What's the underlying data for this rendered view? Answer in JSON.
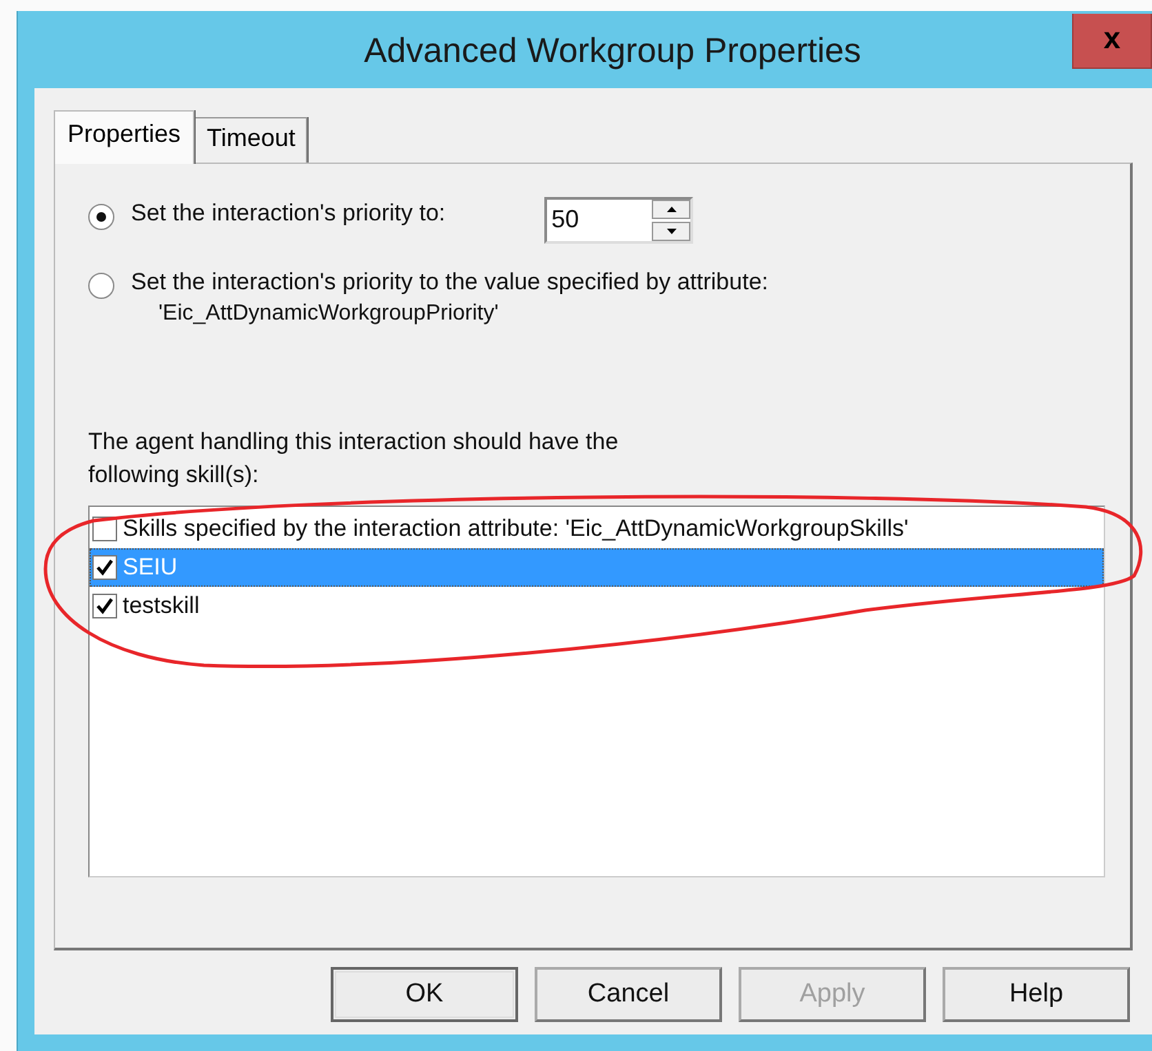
{
  "window": {
    "title": "Advanced Workgroup Properties",
    "close": "x"
  },
  "tabs": [
    {
      "label": "Properties",
      "selected": true
    },
    {
      "label": "Timeout",
      "selected": false
    }
  ],
  "priority_options": [
    {
      "label": "Set the interaction's priority to:",
      "selected": true,
      "kind": "spinner",
      "value": "50"
    },
    {
      "label": "Set the interaction's priority to the value specified by attribute:",
      "selected": false,
      "kind": "attribute",
      "detail": "'Eic_AttDynamicWorkgroupPriority'"
    }
  ],
  "skills_label": "The agent handling this interaction should have the following skill(s):",
  "skills": [
    {
      "label": "Skills specified by the interaction attribute: 'Eic_AttDynamicWorkgroupSkills'",
      "checked": false,
      "selected": false
    },
    {
      "label": "SEIU",
      "checked": true,
      "selected": true
    },
    {
      "label": "testskill",
      "checked": true,
      "selected": false
    }
  ],
  "buttons": [
    {
      "label": "OK",
      "disabled": false
    },
    {
      "label": "Cancel",
      "disabled": false
    },
    {
      "label": "Apply",
      "disabled": true
    },
    {
      "label": "Help",
      "disabled": false
    }
  ]
}
